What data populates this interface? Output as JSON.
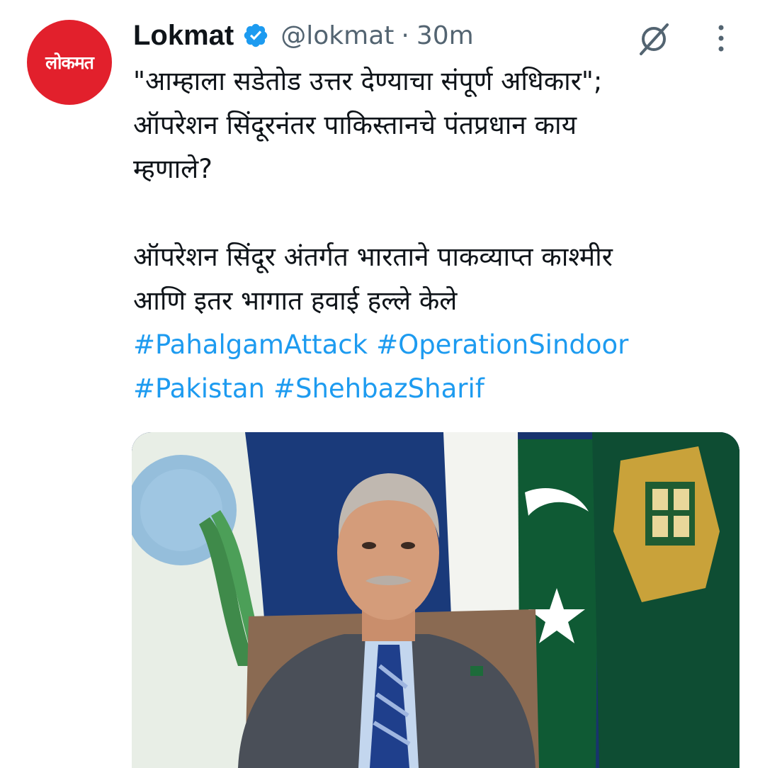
{
  "tweet": {
    "display_name": "Lokmat",
    "handle": "@lokmat",
    "separator": "·",
    "time": "30m",
    "avatar_text": "लोकमत",
    "text_lines": [
      "\"आम्हाला सडेतोड उत्तर देण्याचा संपूर्ण अधिकार\";",
      "ऑपरेशन सिंदूरनंतर पाकिस्तानचे पंतप्रधान काय",
      "म्हणाले?"
    ],
    "text_lines_2": [
      "ऑपरेशन सिंदूर अंतर्गत भारताने पाकव्याप्त काश्मीर",
      "आणि इतर भागात हवाई हल्ले केले"
    ],
    "hashtags_line_1": [
      "#PahalgamAttack",
      "#OperationSindoor"
    ],
    "hashtags_line_2": [
      "#Pakistan",
      "#ShehbazSharif"
    ]
  },
  "icons": {
    "verified": "verified-badge-icon",
    "grok": "grok-icon",
    "more": "more-options-icon"
  },
  "colors": {
    "link": "#1d9bf0",
    "verified": "#1d9bf0",
    "avatar_bg": "#e2202c",
    "secondary_text": "#536471",
    "primary_text": "#0f1419"
  }
}
